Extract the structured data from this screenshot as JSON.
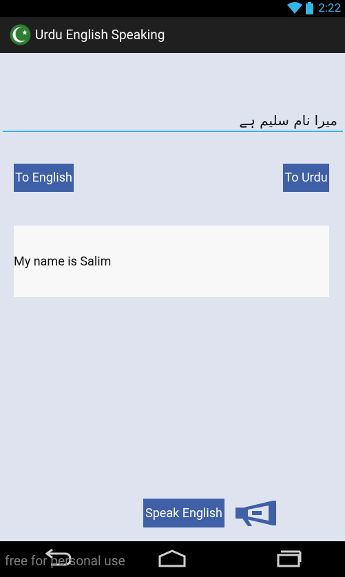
{
  "status_bar": {
    "time": "2:22"
  },
  "app_bar": {
    "title": "Urdu English Speaking"
  },
  "input": {
    "value": "میرا نام سلیم ہے"
  },
  "buttons": {
    "to_english": "To English",
    "to_urdu": "To Urdu",
    "speak_english": "Speak English"
  },
  "result": {
    "text": "My name is Salim"
  },
  "watermark": "free for personal use",
  "colors": {
    "accent": "#33b5e5",
    "button": "#3f5fa7",
    "background": "#dfe3ef"
  }
}
